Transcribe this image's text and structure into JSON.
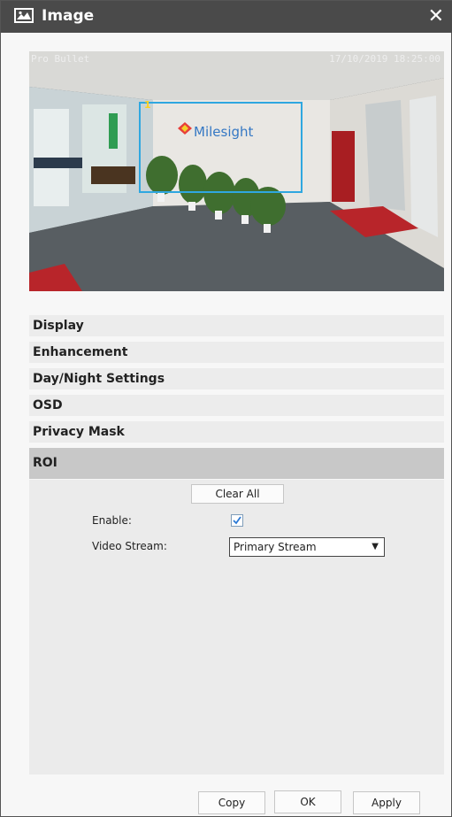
{
  "window": {
    "title": "Image",
    "icon": "image-icon",
    "close_icon": "close-icon"
  },
  "preview": {
    "camera_name": "Pro Bullet",
    "timestamp": "17/10/2019 18:25:00",
    "roi_region_number": "1",
    "roi_color": "#2fa7e0",
    "brand_text": "Milesight"
  },
  "sections": [
    {
      "label": "Display"
    },
    {
      "label": "Enhancement"
    },
    {
      "label": "Day/Night Settings"
    },
    {
      "label": "OSD"
    },
    {
      "label": "Privacy Mask"
    },
    {
      "label": "ROI",
      "active": true
    }
  ],
  "roi": {
    "clear_all_label": "Clear All",
    "enable_label": "Enable:",
    "enable_checked": true,
    "video_stream_label": "Video Stream:",
    "video_stream_value": "Primary Stream"
  },
  "footer": {
    "copy_label": "Copy",
    "ok_label": "OK",
    "apply_label": "Apply"
  }
}
